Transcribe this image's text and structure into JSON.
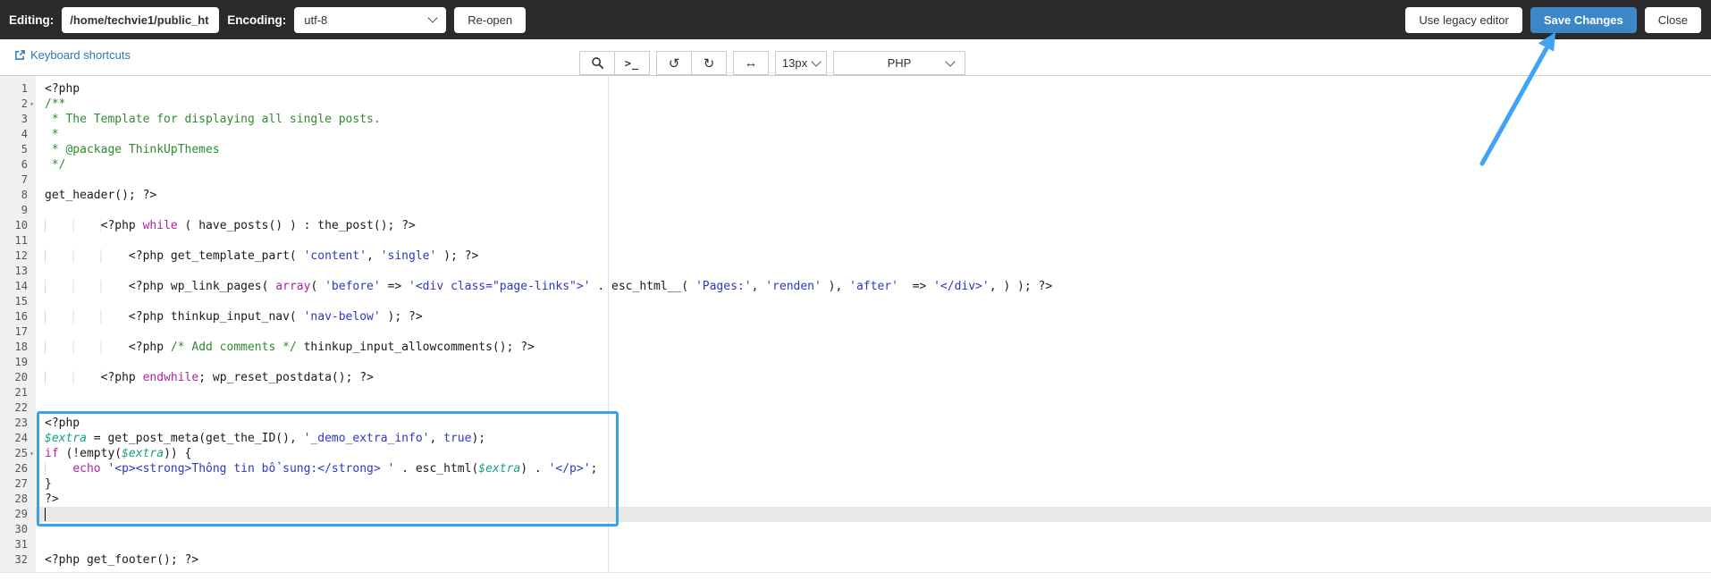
{
  "topbar": {
    "editing_label": "Editing:",
    "path_value": "/home/techvie1/public_ht",
    "encoding_label": "Encoding:",
    "encoding_value": "utf-8",
    "reopen_label": "Re-open",
    "legacy_label": "Use legacy editor",
    "save_label": "Save Changes",
    "close_label": "Close"
  },
  "toolbar": {
    "shortcuts_label": "Keyboard shortcuts",
    "terminal_icon_text": ">_",
    "undo_icon": "↺",
    "redo_icon": "↻",
    "fit_icon": "↔",
    "font_size_value": "13px",
    "mode_value": "PHP"
  },
  "colors": {
    "topbar_bg": "#2a2a2a",
    "save_button": "#3c87c8",
    "link": "#2b79b8",
    "highlight_box": "#38a1f2",
    "arrow": "#41a3f5",
    "comment": "#2e8b2e",
    "keyword": "#a626a4",
    "string": "#2d36c6",
    "variable": "#16a085"
  },
  "annotation": {
    "type": "arrow-and-box",
    "arrow_points_to": "Save Changes",
    "highlighted_lines": "23-29"
  },
  "editor": {
    "fold_marker": "▾",
    "active_line": 29,
    "lines": [
      {
        "n": 1,
        "seg": [
          [
            "<?php",
            ""
          ]
        ]
      },
      {
        "n": 2,
        "fold": true,
        "seg": [
          [
            "/**",
            "c"
          ]
        ]
      },
      {
        "n": 3,
        "seg": [
          [
            " * The Template for displaying all single posts.",
            "c"
          ]
        ]
      },
      {
        "n": 4,
        "seg": [
          [
            " *",
            "c"
          ]
        ]
      },
      {
        "n": 5,
        "seg": [
          [
            " * @package ThinkUpThemes",
            "c"
          ]
        ]
      },
      {
        "n": 6,
        "seg": [
          [
            " */",
            "c"
          ]
        ]
      },
      {
        "n": 7,
        "seg": []
      },
      {
        "n": 8,
        "seg": [
          [
            "get_header(); ?>",
            ""
          ]
        ]
      },
      {
        "n": 9,
        "seg": []
      },
      {
        "n": 10,
        "seg": [
          [
            "        ",
            "ws"
          ],
          [
            "<?php ",
            ""
          ],
          [
            "while",
            "k"
          ],
          [
            " ( have_posts() ) : the_post(); ?>",
            ""
          ]
        ]
      },
      {
        "n": 11,
        "seg": []
      },
      {
        "n": 12,
        "seg": [
          [
            "            ",
            "ws"
          ],
          [
            "<?php get_template_part( ",
            ""
          ],
          [
            "'content'",
            "s"
          ],
          [
            ", ",
            ""
          ],
          [
            "'single'",
            "s"
          ],
          [
            " ); ?>",
            ""
          ]
        ]
      },
      {
        "n": 13,
        "seg": []
      },
      {
        "n": 14,
        "seg": [
          [
            "            ",
            "ws"
          ],
          [
            "<?php wp_link_pages( ",
            ""
          ],
          [
            "array",
            "k"
          ],
          [
            "( ",
            ""
          ],
          [
            "'before'",
            "s"
          ],
          [
            " => ",
            ""
          ],
          [
            "'<div class=\"page-links\">'",
            "s"
          ],
          [
            " . esc_html__( ",
            ""
          ],
          [
            "'Pages:'",
            "s"
          ],
          [
            ", ",
            ""
          ],
          [
            "'renden'",
            "s"
          ],
          [
            " ), ",
            ""
          ],
          [
            "'after'",
            "s"
          ],
          [
            "  => ",
            ""
          ],
          [
            "'</div>'",
            "s"
          ],
          [
            ", ) ); ?>",
            ""
          ]
        ]
      },
      {
        "n": 15,
        "seg": []
      },
      {
        "n": 16,
        "seg": [
          [
            "            ",
            "ws"
          ],
          [
            "<?php thinkup_input_nav( ",
            ""
          ],
          [
            "'nav-below'",
            "s"
          ],
          [
            " ); ?>",
            ""
          ]
        ]
      },
      {
        "n": 17,
        "seg": []
      },
      {
        "n": 18,
        "seg": [
          [
            "            ",
            "ws"
          ],
          [
            "<?php ",
            ""
          ],
          [
            "/* Add comments */",
            "c"
          ],
          [
            " thinkup_input_allowcomments(); ?>",
            ""
          ]
        ]
      },
      {
        "n": 19,
        "seg": []
      },
      {
        "n": 20,
        "seg": [
          [
            "        ",
            "ws"
          ],
          [
            "<?php ",
            ""
          ],
          [
            "endwhile",
            "k"
          ],
          [
            "; wp_reset_postdata(); ?>",
            ""
          ]
        ]
      },
      {
        "n": 21,
        "seg": []
      },
      {
        "n": 22,
        "seg": []
      },
      {
        "n": 23,
        "seg": [
          [
            "<?php",
            ""
          ]
        ]
      },
      {
        "n": 24,
        "seg": [
          [
            "$extra",
            "v"
          ],
          [
            " = get_post_meta(get_the_ID(), ",
            ""
          ],
          [
            "'_demo_extra_info'",
            "s"
          ],
          [
            ", ",
            ""
          ],
          [
            "true",
            "a"
          ],
          [
            ");",
            ""
          ]
        ]
      },
      {
        "n": 25,
        "fold": true,
        "seg": [
          [
            "if",
            "k"
          ],
          [
            " (!empty(",
            ""
          ],
          [
            "$extra",
            "v"
          ],
          [
            ")) {",
            ""
          ]
        ]
      },
      {
        "n": 26,
        "seg": [
          [
            "    ",
            "ws"
          ],
          [
            "echo",
            "k"
          ],
          [
            " ",
            ""
          ],
          [
            "'<p><strong>Thông tin bổ sung:</strong> '",
            "s"
          ],
          [
            " . esc_html(",
            ""
          ],
          [
            "$extra",
            "v"
          ],
          [
            ") . ",
            ""
          ],
          [
            "'</p>'",
            "s"
          ],
          [
            ";",
            ""
          ]
        ]
      },
      {
        "n": 27,
        "seg": [
          [
            "}",
            ""
          ]
        ]
      },
      {
        "n": 28,
        "seg": [
          [
            "?>",
            ""
          ]
        ]
      },
      {
        "n": 29,
        "seg": [],
        "active": true,
        "cursor": true
      },
      {
        "n": 30,
        "seg": []
      },
      {
        "n": 31,
        "seg": []
      },
      {
        "n": 32,
        "seg": [
          [
            "<?php get_footer(); ?>",
            ""
          ]
        ]
      }
    ]
  }
}
